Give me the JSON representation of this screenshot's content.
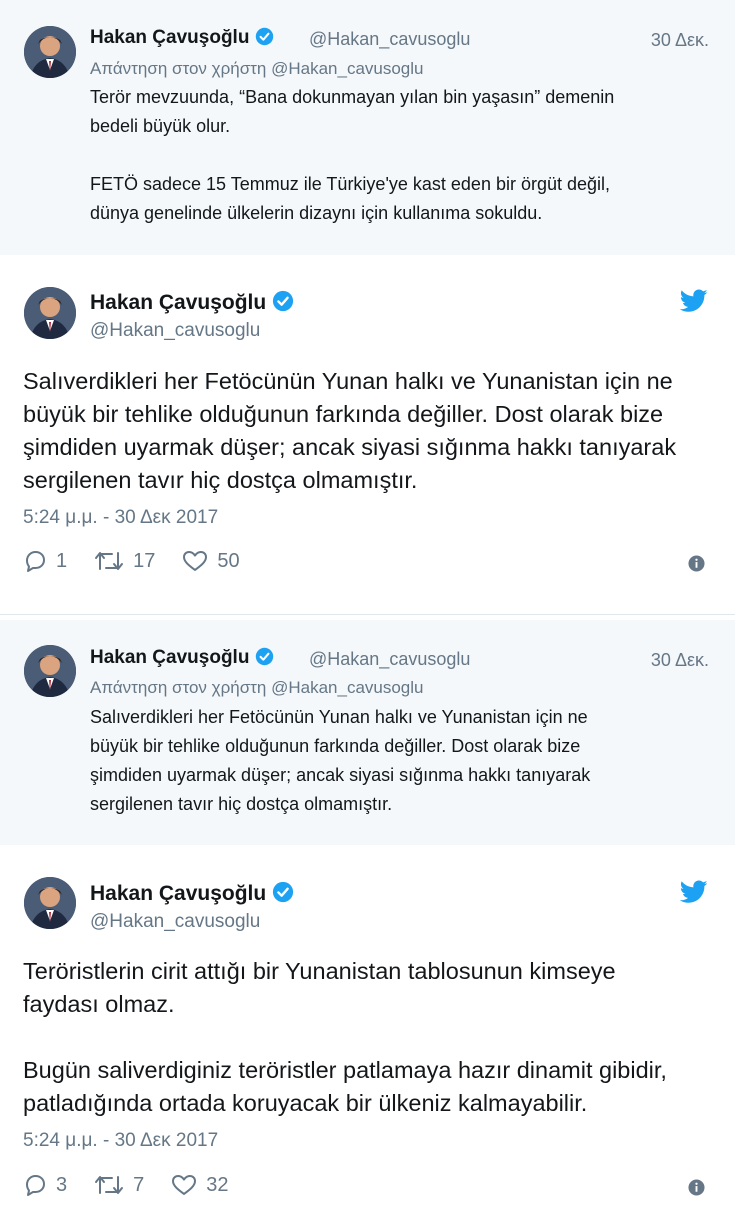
{
  "reply_tweets": [
    {
      "name": "Hakan Çavuşoğlu",
      "handle": "@Hakan_cavusoglu",
      "date": "30 Δεκ.",
      "reply_prefix": "Απάντηση στον χρήστη",
      "reply_handle": "@Hakan_cavusoglu",
      "text": "Terör mevzuunda, “Bana dokunmayan yılan bin yaşasın” demenin\nbedeli büyük olur.\n\nFETÖ sadece 15 Temmuz ile Türkiye'ye kast eden bir örgüt değil,\ndünya genelinde ülkelerin dizaynı için kullanıma sokuldu."
    },
    {
      "name": "Hakan Çavuşoğlu",
      "handle": "@Hakan_cavusoglu",
      "date": "30 Δεκ.",
      "reply_prefix": "Απάντηση στον χρήστη",
      "reply_handle": "@Hakan_cavusoglu",
      "text": "Salıverdikleri her Fetöcünün Yunan halkı ve Yunanistan için ne\nbüyük bir tehlike olduğunun farkında değiller. Dost olarak bize\nşimdiden uyarmak düşer; ancak siyasi sığınma hakkı tanıyarak\nsergilenen tavır hiç dostça olmamıştır."
    }
  ],
  "main_tweets": [
    {
      "name": "Hakan Çavuşoğlu",
      "handle": "@Hakan_cavusoglu",
      "text": "Salıverdikleri her Fetöcünün Yunan halkı ve Yunanistan için ne\nbüyük bir tehlike olduğunun farkında değiller. Dost olarak bize\nşimdiden uyarmak düşer; ancak siyasi sığınma hakkı tanıyarak\nsergilenen tavır hiç dostça olmamıştır.",
      "timestamp": "5:24 μ.μ. - 30 Δεκ 2017",
      "replies": "1",
      "retweets": "17",
      "likes": "50"
    },
    {
      "name": "Hakan Çavuşoğlu",
      "handle": "@Hakan_cavusoglu",
      "text": "Teröristlerin cirit attığı bir Yunanistan tablosunun kimseye\nfaydası olmaz.\n\nBugün saliverdiginiz teröristler patlamaya hazır dinamit gibidir,\npatladığında ortada koruyacak bir ülkeniz kalmayabilir.",
      "timestamp": "5:24 μ.μ. - 30 Δεκ 2017",
      "replies": "3",
      "retweets": "7",
      "likes": "32"
    }
  ],
  "icons": {
    "verified": "verified-badge-icon",
    "twitter": "twitter-bird-icon",
    "reply": "reply-icon",
    "retweet": "retweet-icon",
    "like": "heart-icon",
    "info": "info-icon"
  },
  "colors": {
    "reply_background": "#f5f8fa",
    "brand_blue": "#1da1f2",
    "muted_text": "#657786",
    "primary_text": "#14171a"
  }
}
